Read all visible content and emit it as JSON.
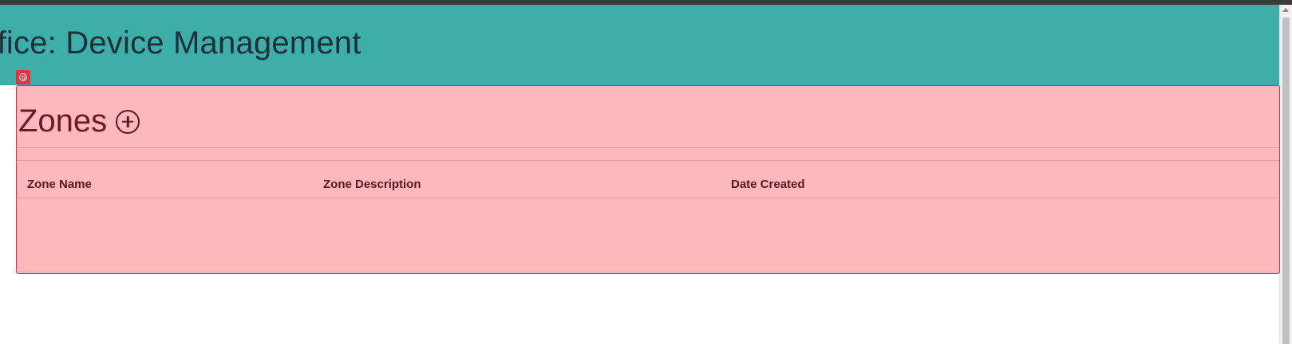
{
  "header": {
    "title": "ffice: Device Management"
  },
  "zones": {
    "title": "Zones",
    "add_icon": "plus-circle-icon",
    "columns": [
      "Zone Name",
      "Zone Description",
      "Date Created"
    ],
    "rows": []
  },
  "overlay": {
    "badge_icon": "target-icon",
    "highlight_color": "#e8313d"
  },
  "colors": {
    "header_bg": "#3daea8",
    "panel_bg": "#fbb9bd"
  }
}
